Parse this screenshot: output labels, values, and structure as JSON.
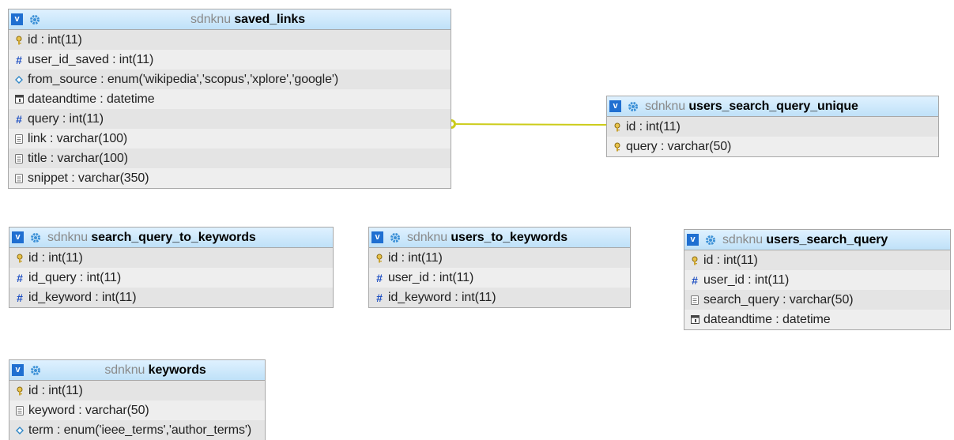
{
  "colors": {
    "header_top": "#dff1ff",
    "header_bottom": "#bfe1f8",
    "toggle_bg": "#1f6fd1",
    "gear": "#3a8fd6",
    "relation_line": "#cccc1a",
    "db_name": "#8a8a8a"
  },
  "toggle_label": "v",
  "tables": {
    "saved_links": {
      "db": "sdnknu",
      "name": "saved_links",
      "columns": [
        {
          "text": "id : int(11)",
          "icon": "key-icon"
        },
        {
          "text": "user_id_saved : int(11)",
          "icon": "hash-icon"
        },
        {
          "text": "from_source : enum('wikipedia','scopus','xplore','google')",
          "icon": "enum-icon"
        },
        {
          "text": "dateandtime : datetime",
          "icon": "calendar-icon"
        },
        {
          "text": "query : int(11)",
          "icon": "hash-icon"
        },
        {
          "text": "link : varchar(100)",
          "icon": "text-icon"
        },
        {
          "text": "title : varchar(100)",
          "icon": "text-icon"
        },
        {
          "text": "snippet : varchar(350)",
          "icon": "text-icon"
        }
      ]
    },
    "users_search_query_unique": {
      "db": "sdnknu",
      "name": "users_search_query_unique",
      "columns": [
        {
          "text": "id : int(11)",
          "icon": "key-icon"
        },
        {
          "text": "query : varchar(50)",
          "icon": "key-icon"
        }
      ]
    },
    "search_query_to_keywords": {
      "db": "sdnknu",
      "name": "search_query_to_keywords",
      "columns": [
        {
          "text": "id : int(11)",
          "icon": "key-icon"
        },
        {
          "text": "id_query : int(11)",
          "icon": "hash-icon"
        },
        {
          "text": "id_keyword : int(11)",
          "icon": "hash-icon"
        }
      ]
    },
    "users_to_keywords": {
      "db": "sdnknu",
      "name": "users_to_keywords",
      "columns": [
        {
          "text": "id : int(11)",
          "icon": "key-icon"
        },
        {
          "text": "user_id : int(11)",
          "icon": "hash-icon"
        },
        {
          "text": "id_keyword : int(11)",
          "icon": "hash-icon"
        }
      ]
    },
    "users_search_query": {
      "db": "sdnknu",
      "name": "users_search_query",
      "columns": [
        {
          "text": "id : int(11)",
          "icon": "key-icon"
        },
        {
          "text": "user_id : int(11)",
          "icon": "hash-icon"
        },
        {
          "text": "search_query : varchar(50)",
          "icon": "text-icon"
        },
        {
          "text": "dateandtime : datetime",
          "icon": "calendar-icon"
        }
      ]
    },
    "keywords": {
      "db": "sdnknu",
      "name": "keywords",
      "columns": [
        {
          "text": "id : int(11)",
          "icon": "key-icon"
        },
        {
          "text": "keyword : varchar(50)",
          "icon": "text-icon"
        },
        {
          "text": "term : enum('ieee_terms','author_terms')",
          "icon": "enum-icon"
        }
      ]
    }
  },
  "relations": [
    {
      "from": "saved_links.query",
      "to": "users_search_query_unique.id"
    }
  ]
}
